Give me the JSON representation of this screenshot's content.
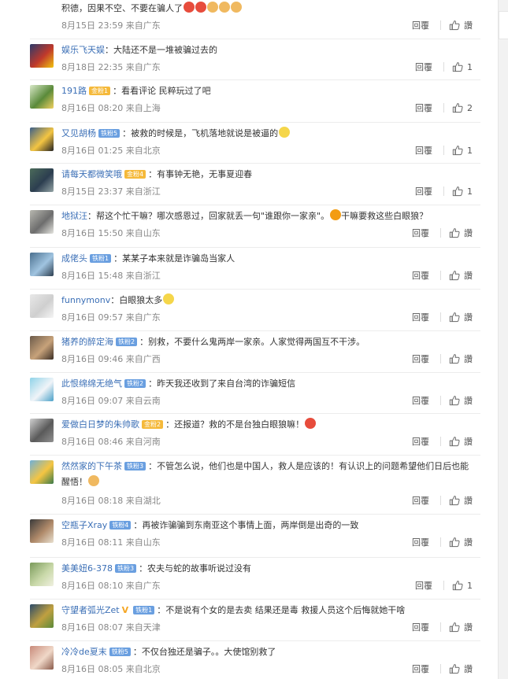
{
  "reply_label": "回覆",
  "comments": [
    {
      "user": "",
      "badge": "",
      "text": "积德，因果不空、不要在骗人了",
      "emoji": [
        "candle",
        "candle",
        "pray",
        "pray",
        "pray"
      ],
      "date": "8月15日 23:59",
      "loc": "来自广东",
      "likes": "讚"
    },
    {
      "user": "娱乐飞天娱",
      "badge": "",
      "text": "：大陆还不是一堆被骗过去的",
      "date": "8月18日 22:35",
      "loc": "来自广东",
      "likes": "1"
    },
    {
      "user": "191路",
      "badge": "金粉1",
      "badge_type": "gold",
      "text": "：看看评论 民粹玩过了吧",
      "date": "8月16日 08:20",
      "loc": "来自上海",
      "likes": "2"
    },
    {
      "user": "又见胡杨",
      "badge": "铁粉5",
      "badge_type": "blue",
      "text": "：被救的时候是，飞机落地就说是被逼的",
      "emoji": [
        "roll"
      ],
      "date": "8月16日 01:25",
      "loc": "来自北京",
      "likes": "1"
    },
    {
      "user": "请每天都微笑哦",
      "badge": "金粉4",
      "badge_type": "gold",
      "text": "：有事钟无艳，无事夏迎春",
      "date": "8月15日 23:37",
      "loc": "来自浙江",
      "likes": "1"
    },
    {
      "user": "地狱汪",
      "badge": "",
      "text": "：帮这个忙干嘛？哪次感恩过，回家就丢一句\"谁跟你一家亲\"。",
      "emoji": [
        "angry"
      ],
      "text2": "干嘛要救这些白眼狼？",
      "date": "8月16日 15:50",
      "loc": "来自山东",
      "likes": "讚"
    },
    {
      "user": "成佬头",
      "badge": "铁粉1",
      "badge_type": "blue",
      "text": "：某某子本来就是诈骗岛当家人",
      "date": "8月16日 15:48",
      "loc": "来自浙江",
      "likes": "讚"
    },
    {
      "user": "funnymonv",
      "badge": "",
      "text": "：白眼狼太多",
      "emoji": [
        "smirk"
      ],
      "date": "8月16日 09:57",
      "loc": "来自广东",
      "likes": "讚"
    },
    {
      "user": "猪养的醉定海",
      "badge": "铁粉2",
      "badge_type": "blue",
      "text": "：别救，不要什么鬼两岸一家亲。人家觉得两国互不干涉。",
      "date": "8月16日 09:46",
      "loc": "来自广西",
      "likes": "讚"
    },
    {
      "user": "此恨绵绵无绝气",
      "badge": "铁粉2",
      "badge_type": "blue",
      "text": "：昨天我还收到了来自台湾的诈骗短信",
      "date": "8月16日 09:07",
      "loc": "来自云南",
      "likes": "讚"
    },
    {
      "user": "爱做白日梦的朱帅歌",
      "badge": "金粉2",
      "badge_type": "gold",
      "text": "：还报道？救的不是台独白眼狼嘛！",
      "emoji": [
        "mad"
      ],
      "date": "8月16日 08:46",
      "loc": "来自河南",
      "likes": "讚"
    },
    {
      "user": "然然家的下午茶",
      "badge": "铁粉3",
      "badge_type": "blue",
      "text": "：不管怎么说，他们也是中国人，救人是应该的！有认识上的问题希望他们日后也能醒悟！",
      "emoji": [
        "fold"
      ],
      "date": "8月16日 08:18",
      "loc": "来自湖北",
      "likes": "讚",
      "tall": true
    },
    {
      "user": "空瓶子Xray",
      "badge": "铁粉4",
      "badge_type": "blue",
      "text": "：再被诈骗骗到东南亚这个事情上面，两岸倒是出奇的一致",
      "date": "8月16日 08:11",
      "loc": "来自山东",
      "likes": "讚"
    },
    {
      "user": "美美妞6-378",
      "badge": "铁粉3",
      "badge_type": "blue",
      "text": "：农夫与蛇的故事听说过没有",
      "date": "8月16日 08:10",
      "loc": "来自广东",
      "likes": "1"
    },
    {
      "user": "守望者弧光Zet",
      "vip": "V",
      "badge": "铁粉1",
      "badge_type": "blue",
      "text": "：不是说有个女的是去卖 结果还是毒 救援人员这个后悔就她干啥",
      "date": "8月16日 08:07",
      "loc": "来自天津",
      "likes": "讚"
    },
    {
      "user": "冷冷de夏末",
      "badge": "铁粉5",
      "badge_type": "blue",
      "text": "：不仅台独还是骗子。。大使馆别救了",
      "date": "8月16日 08:05",
      "loc": "来自北京",
      "likes": "讚"
    }
  ]
}
